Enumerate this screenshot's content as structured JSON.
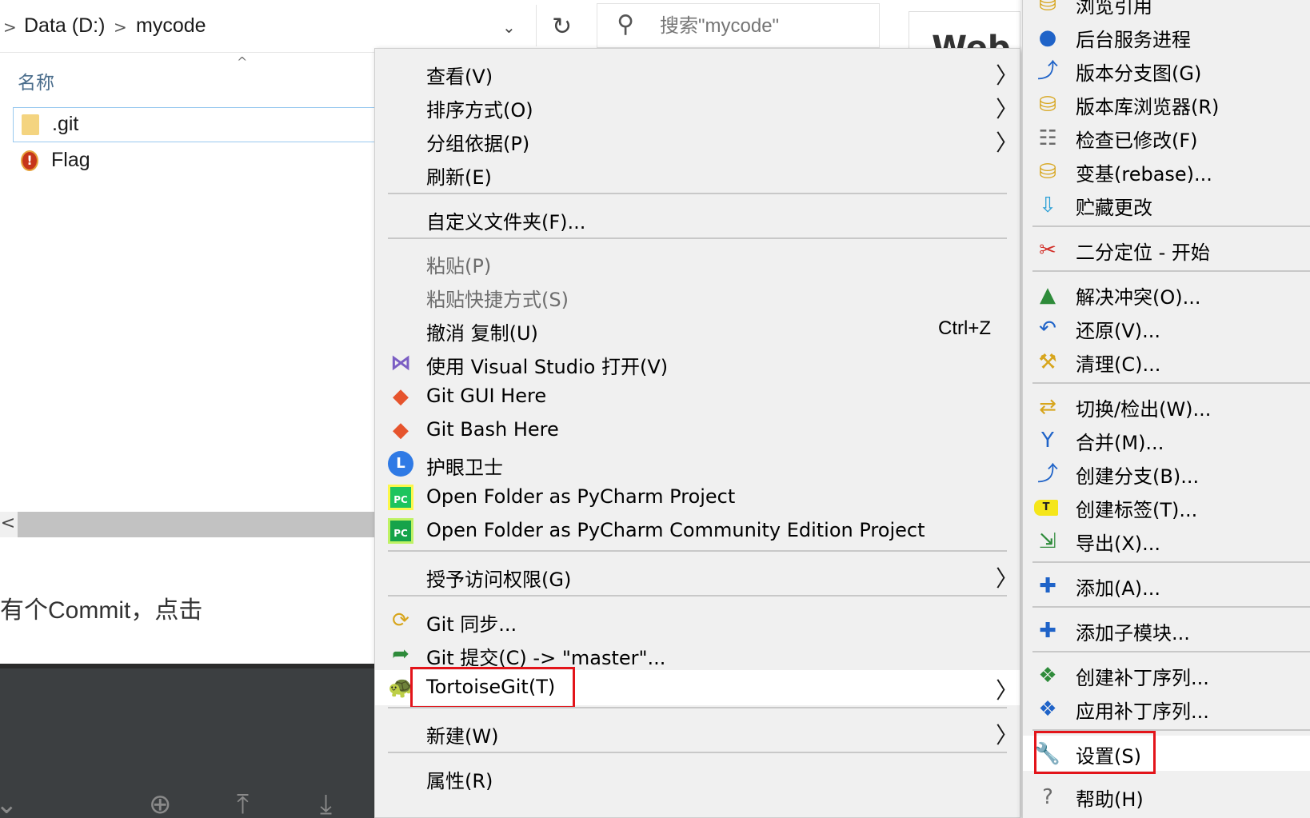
{
  "explorer": {
    "breadcrumb": [
      ">",
      "Data (D:)",
      ">",
      "mycode"
    ],
    "dropdown_glyph": "⌄",
    "refresh_glyph": "↻",
    "search_placeholder": "搜索\"mycode\"",
    "column_name": "名称",
    "sort_glyph": "^",
    "files": [
      {
        "name": ".git",
        "icon": "folder-icon"
      },
      {
        "name": "Flag",
        "icon": "flag-icon"
      }
    ],
    "scroll_left_glyph": "<"
  },
  "background": {
    "article_text": "有个Commit，点击",
    "heading_fragment": "Web I"
  },
  "context_menu": {
    "items": [
      {
        "label": "查看(V)",
        "submenu": true
      },
      {
        "label": "排序方式(O)",
        "submenu": true
      },
      {
        "label": "分组依据(P)",
        "submenu": true
      },
      {
        "label": "刷新(E)"
      },
      {
        "label": "自定义文件夹(F)..."
      },
      {
        "label": "粘贴(P)",
        "disabled": true
      },
      {
        "label": "粘贴快捷方式(S)",
        "disabled": true
      },
      {
        "label": "撤消 复制(U)",
        "shortcut": "Ctrl+Z"
      },
      {
        "label": "使用 Visual Studio 打开(V)",
        "icon": "visual-studio-icon"
      },
      {
        "label": "Git GUI Here",
        "icon": "git-icon"
      },
      {
        "label": "Git Bash Here",
        "icon": "git-icon"
      },
      {
        "label": "护眼卫士",
        "icon": "eye-guard-icon"
      },
      {
        "label": "Open Folder as PyCharm Project",
        "icon": "pycharm-icon"
      },
      {
        "label": "Open Folder as PyCharm Community Edition Project",
        "icon": "pycharm-ce-icon"
      },
      {
        "label": "授予访问权限(G)",
        "submenu": true
      },
      {
        "label": "Git 同步...",
        "icon": "git-sync-icon"
      },
      {
        "label": "Git 提交(C) -> \"master\"...",
        "icon": "git-commit-icon"
      },
      {
        "label": "TortoiseGit(T)",
        "icon": "tortoisegit-icon",
        "submenu": true,
        "highlighted": true
      },
      {
        "label": "新建(W)",
        "submenu": true
      },
      {
        "label": "属性(R)"
      }
    ],
    "arrow_glyph": "〉"
  },
  "tortoise_submenu": {
    "items": [
      {
        "label": "浏览引用",
        "icon": "browse-refs-icon"
      },
      {
        "label": "后台服务进程",
        "icon": "globe-icon"
      },
      {
        "label": "版本分支图(G)",
        "icon": "revision-graph-icon"
      },
      {
        "label": "版本库浏览器(R)",
        "icon": "repo-browser-icon"
      },
      {
        "label": "检查已修改(F)",
        "icon": "check-modifications-icon"
      },
      {
        "label": "变基(rebase)...",
        "icon": "rebase-icon"
      },
      {
        "label": "贮藏更改",
        "icon": "stash-icon"
      },
      {
        "label": "二分定位 - 开始",
        "icon": "bisect-icon"
      },
      {
        "label": "解决冲突(O)...",
        "icon": "resolve-icon"
      },
      {
        "label": "还原(V)...",
        "icon": "revert-icon"
      },
      {
        "label": "清理(C)...",
        "icon": "cleanup-icon"
      },
      {
        "label": "切换/检出(W)...",
        "icon": "switch-icon"
      },
      {
        "label": "合并(M)...",
        "icon": "merge-icon"
      },
      {
        "label": "创建分支(B)...",
        "icon": "branch-icon"
      },
      {
        "label": "创建标签(T)...",
        "icon": "tag-icon",
        "tag_letter": "T"
      },
      {
        "label": "导出(X)...",
        "icon": "export-icon"
      },
      {
        "label": "添加(A)...",
        "icon": "add-icon"
      },
      {
        "label": "添加子模块...",
        "icon": "add-submodule-icon"
      },
      {
        "label": "创建补丁序列...",
        "icon": "create-patch-icon"
      },
      {
        "label": "应用补丁序列...",
        "icon": "apply-patch-icon"
      },
      {
        "label": "设置(S)",
        "icon": "wrench-icon",
        "highlighted": true
      },
      {
        "label": "帮助(H)",
        "icon": "help-icon"
      }
    ]
  },
  "colors": {
    "menu_bg": "#f0f0f0",
    "highlight_box": "#e3141a",
    "selection_border": "#99c9ef",
    "dark_panel": "#3c3f41"
  }
}
